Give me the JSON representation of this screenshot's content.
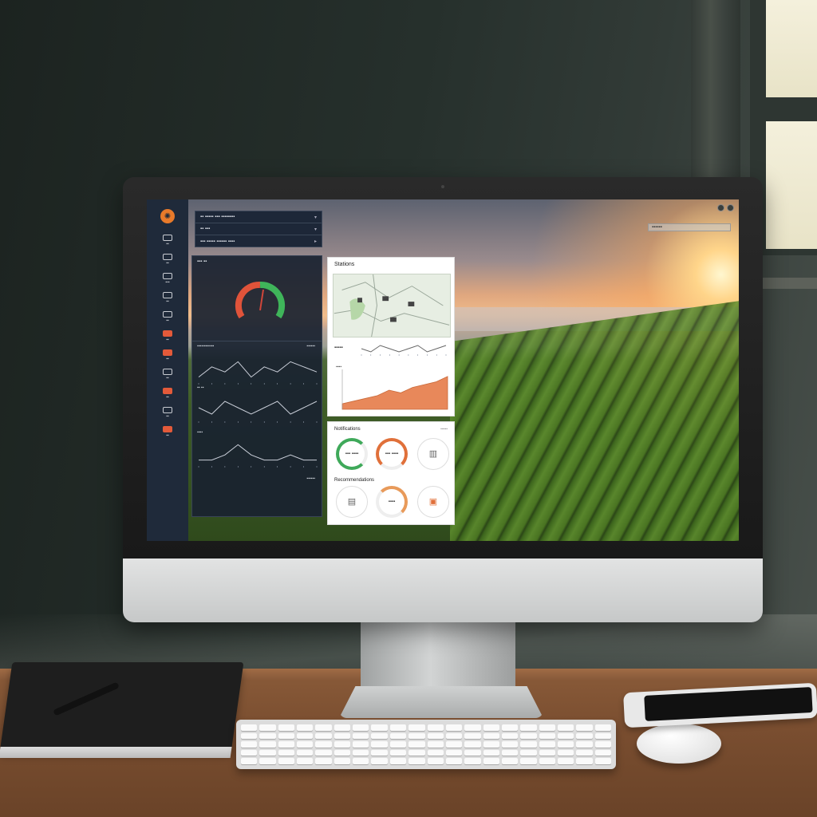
{
  "colors": {
    "sidebar_bg": "#1f2a3a",
    "accent_orange": "#e87a2a",
    "gauge_red": "#e0533a",
    "gauge_green": "#3fb55a",
    "chart_orange": "#e8885a",
    "ring_green": "#3fa95a",
    "ring_orange": "#e0703a"
  },
  "sidebar": {
    "logo_icon": "gear-icon",
    "items": [
      {
        "label": "▪▪",
        "alert": false
      },
      {
        "label": "▪▪",
        "alert": false
      },
      {
        "label": "▪▪▪",
        "alert": false
      },
      {
        "label": "▪▪",
        "alert": false
      },
      {
        "label": "▪▪",
        "alert": false
      },
      {
        "label": "▪▪",
        "alert": true
      },
      {
        "label": "▪▪",
        "alert": true
      },
      {
        "label": "▪▪",
        "alert": false
      },
      {
        "label": "▪▪",
        "alert": true
      },
      {
        "label": "▪▪",
        "alert": false
      },
      {
        "label": "▪▪",
        "alert": true
      }
    ]
  },
  "header": {
    "title": "▪▪ ▪▪▪▪▪ ▪▪▪ ▪▪▪▪▪▪▪▪",
    "row2": "▪▪ ▪▪▪",
    "row3": "▪▪▪ ▪▪▪▪▪ ▪▪▪▪▪▪ ▪▪▪▪"
  },
  "dark_panel": {
    "title": "▪▪▪ ▪▪",
    "labels": [
      "▪▪▪▪▪▪▪▪▪▪▪▪",
      "▪▪▪▪▪▪",
      "▪▪ ▪▪",
      "▪▪▪▪",
      "▪▪▪▪▪▪"
    ],
    "gauge_fraction": 0.55
  },
  "map_panel": {
    "title": "Stations",
    "wave_label": "▪▪▪▪▪",
    "area_label": "▪▪▪▪"
  },
  "status_panel": {
    "title": "Notifications",
    "subtitle": "Recommendations",
    "corner": "▪▪▪▪▪",
    "ring_a": "▪▪▪ ▪▪▪▪",
    "ring_b": "▪▪▪ ▪▪▪▪",
    "ring_e": "▪▪▪▪"
  },
  "screen": {
    "search_placeholder": "▪▪▪▪▪▪"
  },
  "chart_data": [
    {
      "type": "line",
      "x": [
        1,
        2,
        3,
        4,
        5,
        6,
        7,
        8,
        9,
        10
      ],
      "y": [
        3,
        5,
        4,
        6,
        3,
        5,
        4,
        6,
        5,
        4
      ]
    },
    {
      "type": "line",
      "x": [
        1,
        2,
        3,
        4,
        5,
        6,
        7,
        8,
        9,
        10
      ],
      "y": [
        4,
        3,
        5,
        4,
        3,
        4,
        5,
        3,
        4,
        5
      ]
    },
    {
      "type": "line",
      "x": [
        1,
        2,
        3,
        4,
        5,
        6,
        7,
        8,
        9,
        10
      ],
      "y": [
        2,
        2,
        3,
        5,
        3,
        2,
        2,
        3,
        2,
        2
      ]
    },
    {
      "type": "area",
      "x": [
        1,
        2,
        3,
        4,
        5,
        6,
        7,
        8,
        9,
        10
      ],
      "y": [
        1,
        1.5,
        2,
        2.5,
        3.5,
        3,
        4,
        4.5,
        5,
        6
      ]
    }
  ]
}
